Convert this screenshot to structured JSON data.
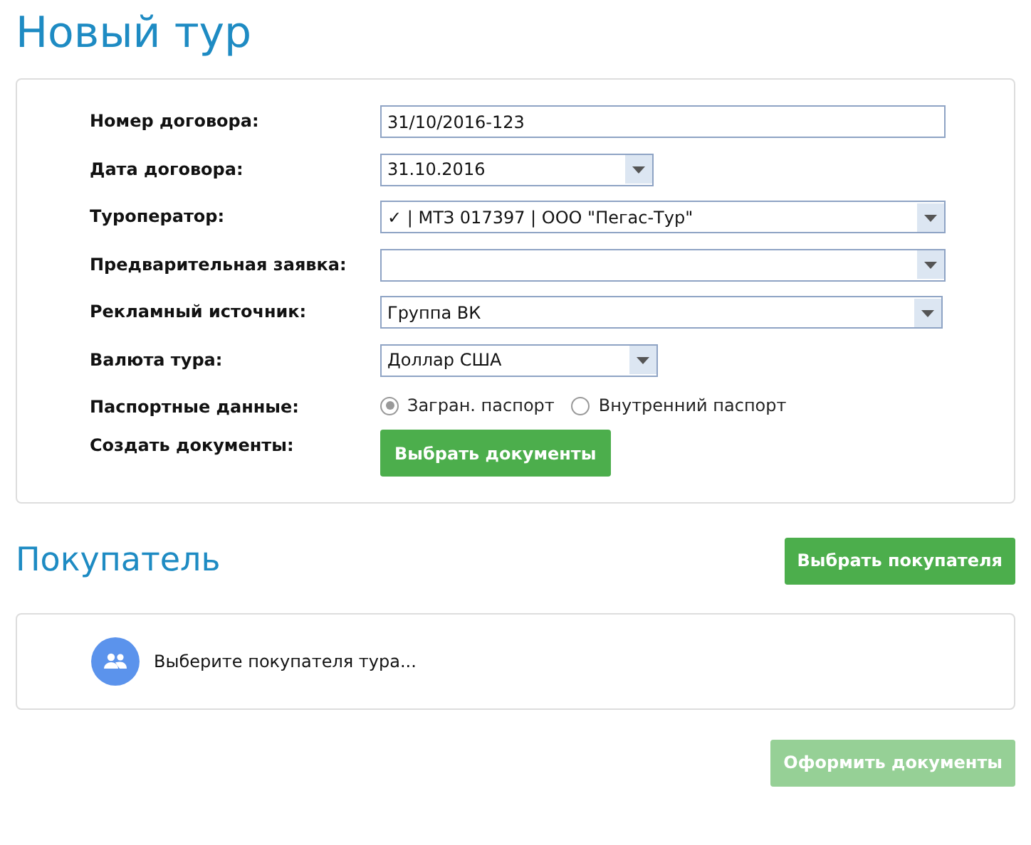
{
  "title": "Новый тур",
  "form": {
    "rows": [
      {
        "label": "Номер договора:",
        "kind": "text",
        "value": "31/10/2016-123"
      },
      {
        "label": "Дата договора:",
        "kind": "select",
        "value": "31.10.2016"
      },
      {
        "label": "Туроператор:",
        "kind": "select",
        "value": "✓ | МТЗ 017397 | ООО \"Пегас-Тур\""
      },
      {
        "label": "Предварительная заявка:",
        "kind": "select",
        "value": ""
      },
      {
        "label": "Рекламный источник:",
        "kind": "select",
        "value": "Группа ВК"
      },
      {
        "label": "Валюта тура:",
        "kind": "select",
        "value": "Доллар США"
      },
      {
        "label": "Паспортные данные:",
        "kind": "radio",
        "options": [
          {
            "label": "Загран. паспорт",
            "selected": true
          },
          {
            "label": "Внутренний паспорт",
            "selected": false
          }
        ]
      },
      {
        "label": "Создать документы:",
        "kind": "button",
        "button": "Выбрать документы"
      }
    ]
  },
  "buyer": {
    "heading": "Покупатель",
    "button": "Выбрать покупателя",
    "prompt": "Выберите покупателя тура..."
  },
  "submit": {
    "label": "Оформить документы",
    "disabled": true
  }
}
